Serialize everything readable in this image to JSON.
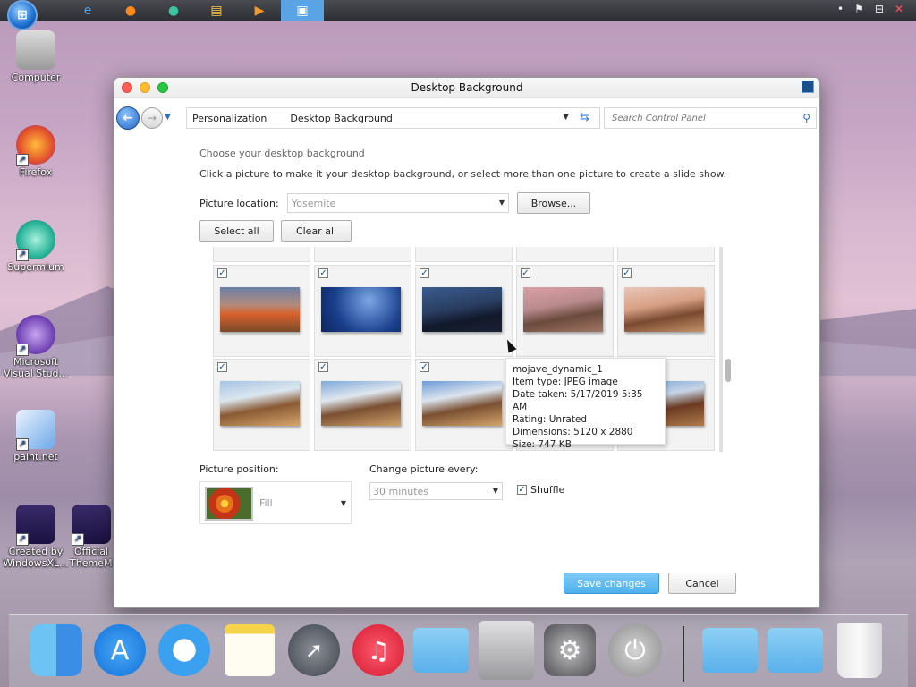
{
  "colors": {
    "accent": "#4fb0ee",
    "traffic_close": "#fc5f57",
    "traffic_min": "#fdbc2e",
    "traffic_max": "#28c840"
  },
  "taskbar": {
    "items": [
      "start-orb",
      "ie-icon",
      "firefox-icon",
      "supermium-icon",
      "explorer-icon",
      "media-player-icon",
      "control-panel-icon"
    ],
    "tray": [
      "dot",
      "flag-icon",
      "network-icon",
      "volume-muted-icon"
    ]
  },
  "desktop": {
    "icons": [
      {
        "label": "Computer"
      },
      {
        "label": "Firefox"
      },
      {
        "label": "Supermium"
      },
      {
        "label": "Microsoft Visual Stud..."
      },
      {
        "label": "paint.net"
      },
      {
        "label": "Created by WindowsXL..."
      },
      {
        "label": "Official ThemeM..."
      }
    ]
  },
  "window": {
    "title": "Desktop Background",
    "breadcrumb": [
      "Personalization",
      "Desktop Background"
    ],
    "search_placeholder": "Search Control Panel",
    "heading": "Choose your desktop background",
    "subheading": "Click a picture to make it your desktop background, or select more than one picture to create a slide show.",
    "picture_location_label": "Picture location:",
    "picture_location_value": "Yosemite",
    "browse_label": "Browse...",
    "select_all_label": "Select all",
    "clear_all_label": "Clear all",
    "picture_position_label": "Picture position:",
    "picture_position_value": "Fill",
    "change_every_label": "Change picture every:",
    "change_every_value": "30 minutes",
    "shuffle_label": "Shuffle",
    "save_label": "Save changes",
    "cancel_label": "Cancel",
    "thumbnails": [
      {
        "name": "high-sierra",
        "checked": true
      },
      {
        "name": "blue-sky",
        "checked": true
      },
      {
        "name": "mojave-night",
        "checked": true
      },
      {
        "name": "mojave-dusk",
        "checked": true
      },
      {
        "name": "mojave-dusk-2",
        "checked": true
      },
      {
        "name": "mojave-day-1",
        "checked": true
      },
      {
        "name": "mojave-day-2",
        "checked": true
      },
      {
        "name": "mojave-day-3",
        "checked": true
      },
      {
        "name": "mojave-day-4",
        "checked": false
      },
      {
        "name": "mojave-day-5",
        "checked": false
      }
    ],
    "tooltip": {
      "name": "mojave_dynamic_1",
      "type": "Item type: JPEG image",
      "date": "Date taken: 5/17/2019 5:35 AM",
      "rating": "Rating: Unrated",
      "dimensions": "Dimensions: 5120 x 2880",
      "size": "Size: 747 KB"
    }
  },
  "dock": {
    "items": [
      "finder-icon",
      "app-store-icon",
      "safari-icon",
      "notes-icon",
      "launchpad-icon",
      "music-icon",
      "folder-icon",
      "mac-pro-icon",
      "settings-icon",
      "power-icon",
      "folder-icon-2",
      "documents-folder-icon",
      "trash-icon"
    ]
  }
}
